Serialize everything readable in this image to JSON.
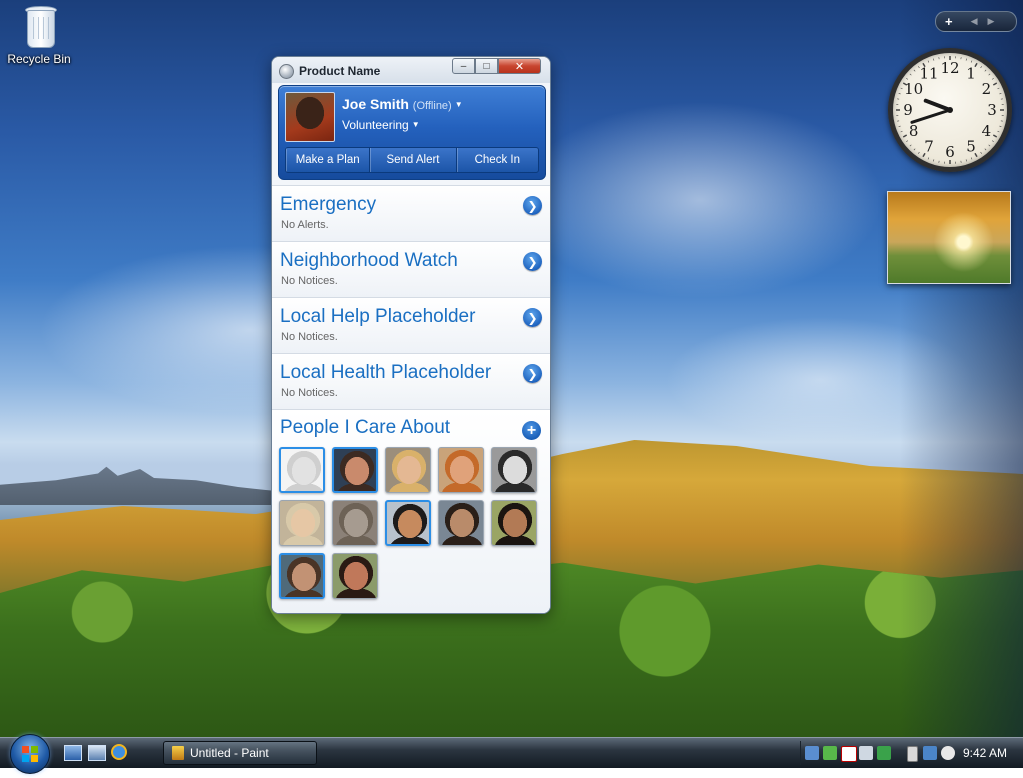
{
  "desktop": {
    "recycle_bin_label": "Recycle Bin"
  },
  "window": {
    "title": "Product Name",
    "controls": {
      "minimize_icon": "minimize-icon",
      "maximize_icon": "maximize-icon",
      "close_icon": "close-icon"
    }
  },
  "profile": {
    "name": "Joe Smith",
    "status": "(Offline)",
    "activity": "Volunteering",
    "actions": [
      "Make a Plan",
      "Send Alert",
      "Check In"
    ]
  },
  "sections": [
    {
      "title": "Emergency",
      "subtitle": "No Alerts."
    },
    {
      "title": "Neighborhood Watch",
      "subtitle": "No Notices."
    },
    {
      "title": "Local Help Placeholder",
      "subtitle": "No Notices."
    },
    {
      "title": "Local Health Placeholder",
      "subtitle": "No Notices."
    }
  ],
  "people": {
    "title": "People I Care About",
    "contacts": [
      {
        "selected": true,
        "skin": "#e2e2e2",
        "hair": "#cfcfcf",
        "bg": "#f4f4f4"
      },
      {
        "selected": true,
        "skin": "#c98a6c",
        "hair": "#3c2a22",
        "bg": "#2e3f55"
      },
      {
        "selected": false,
        "skin": "#e4b893",
        "hair": "#d9b16a",
        "bg": "#9b8e7b"
      },
      {
        "selected": false,
        "skin": "#e0a27a",
        "hair": "#c46a2a",
        "bg": "#c9a37a"
      },
      {
        "selected": false,
        "skin": "#dcdcdc",
        "hair": "#2a2a2a",
        "bg": "#9a9a9a"
      },
      {
        "selected": false,
        "skin": "#e6c7a5",
        "hair": "#d8c9a9",
        "bg": "#c2b49a"
      },
      {
        "selected": false,
        "skin": "#a69b90",
        "hair": "#6d6256",
        "bg": "#8b8178"
      },
      {
        "selected": true,
        "skin": "#c68a5e",
        "hair": "#1d1b1b",
        "bg": "#b8c2cc"
      },
      {
        "selected": false,
        "skin": "#b98b6a",
        "hair": "#2a1f18",
        "bg": "#7a8794"
      },
      {
        "selected": false,
        "skin": "#b27a55",
        "hair": "#1a1410",
        "bg": "#9aa565"
      },
      {
        "selected": true,
        "skin": "#c29274",
        "hair": "#4a3426",
        "bg": "#4f6a7a"
      },
      {
        "selected": false,
        "skin": "#c0785a",
        "hair": "#2a1a14",
        "bg": "#8b9b6a"
      }
    ]
  },
  "sidebar_gadgets": {
    "toolbar_add_icon": "plus-icon",
    "clock_numbers": [
      "12",
      "1",
      "2",
      "3",
      "4",
      "5",
      "6",
      "7",
      "8",
      "9",
      "10",
      "11"
    ],
    "clock_time": {
      "hour": 9,
      "minute": 42
    }
  },
  "taskbar": {
    "task_label": "Untitled - Paint",
    "time": "9:42 AM"
  }
}
